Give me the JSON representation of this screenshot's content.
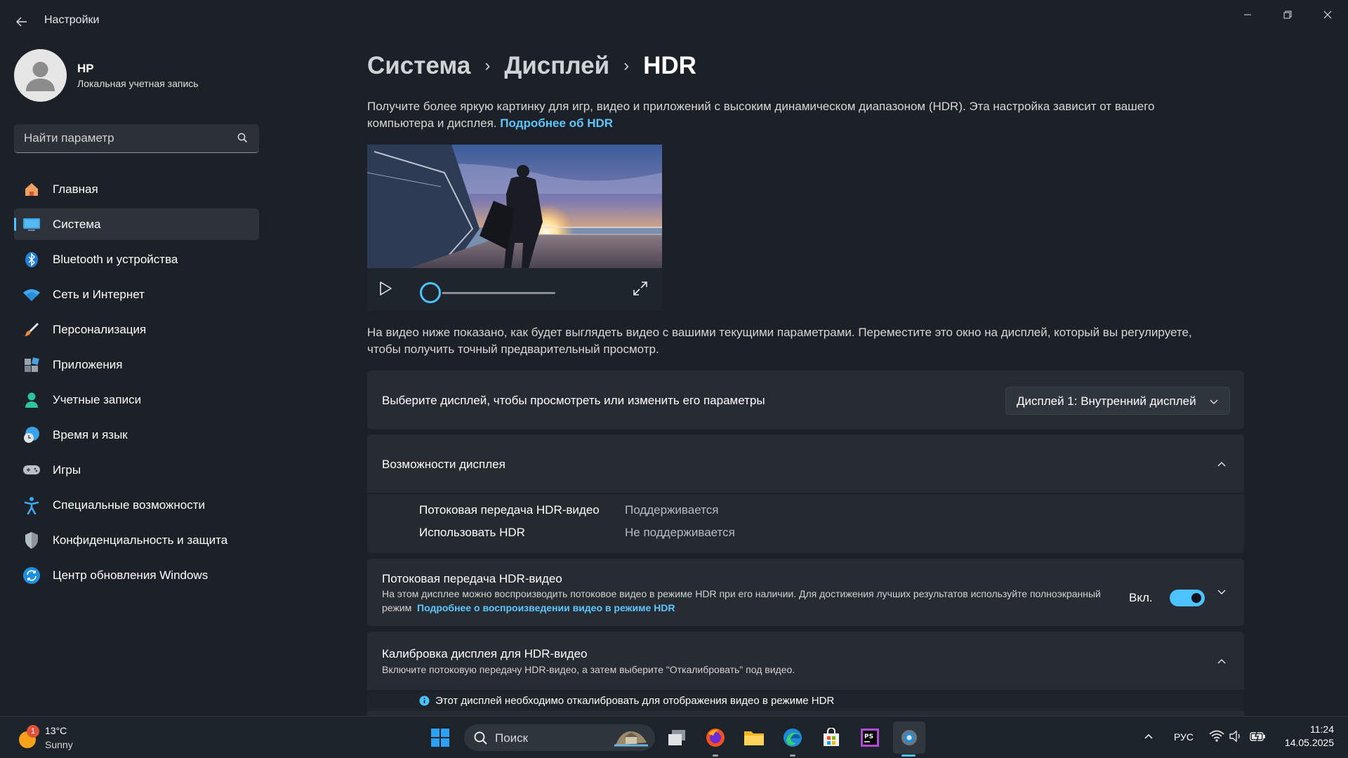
{
  "window": {
    "title": "Настройки"
  },
  "user": {
    "name": "HP",
    "account_type": "Локальная учетная запись"
  },
  "search": {
    "placeholder": "Найти параметр"
  },
  "nav": {
    "items": [
      {
        "label": "Главная",
        "icon": "home-icon"
      },
      {
        "label": "Система",
        "icon": "system-display-icon",
        "active": true
      },
      {
        "label": "Bluetooth и устройства",
        "icon": "bluetooth-icon"
      },
      {
        "label": "Сеть и Интернет",
        "icon": "wifi-icon"
      },
      {
        "label": "Персонализация",
        "icon": "brush-icon"
      },
      {
        "label": "Приложения",
        "icon": "apps-icon"
      },
      {
        "label": "Учетные записи",
        "icon": "person-icon"
      },
      {
        "label": "Время и язык",
        "icon": "globe-clock-icon"
      },
      {
        "label": "Игры",
        "icon": "gamepad-icon"
      },
      {
        "label": "Специальные возможности",
        "icon": "accessibility-icon"
      },
      {
        "label": "Конфиденциальность и защита",
        "icon": "shield-icon"
      },
      {
        "label": "Центр обновления Windows",
        "icon": "update-icon"
      }
    ]
  },
  "breadcrumb": {
    "level1": "Система",
    "level2": "Дисплей",
    "current": "HDR"
  },
  "intro": {
    "text": "Получите более яркую картинку для игр, видео и приложений с высоким динамическом диапазоном (HDR). Эта настройка зависит от вашего компьютера и дисплея.",
    "link": "Подробнее об HDR"
  },
  "video": {
    "progress": 0
  },
  "preview_note": "На видео ниже показано, как будет выглядеть видео с вашими текущими параметрами. Переместите это окно на дисплей, который вы регулируете, чтобы получить точный предварительный просмотр.",
  "display_select": {
    "label": "Выберите дисплей, чтобы просмотреть или изменить его параметры",
    "value": "Дисплей 1: Внутренний дисплей"
  },
  "capabilities": {
    "title": "Возможности дисплея",
    "rows": [
      {
        "label": "Потоковая передача HDR-видео",
        "value": "Поддерживается"
      },
      {
        "label": "Использовать HDR",
        "value": "Не поддерживается"
      }
    ]
  },
  "hdr_streaming": {
    "title": "Потоковая передача HDR-видео",
    "description": "На этом дисплее можно воспроизводить потоковое видео в режиме HDR при его наличии. Для достижения лучших результатов используйте полноэкранный режим",
    "link": "Подробнее о воспроизведении видео в режиме HDR",
    "toggle_label": "Вкл.",
    "toggle_on": true
  },
  "calibration": {
    "title": "Калибровка дисплея для HDR-видео",
    "subtitle": "Включите потоковую передачу HDR-видео, а затем выберите \"Откалибровать\" под видео.",
    "info": "Этот дисплей необходимо откалибровать для отображения видео в режиме HDR"
  },
  "taskbar": {
    "weather": {
      "temp": "13°C",
      "condition": "Sunny",
      "badge": "1"
    },
    "search_placeholder": "Поиск",
    "language": "РУС",
    "time": "11:24",
    "date": "14.05.2025"
  },
  "colors": {
    "accent": "#4cc2ff",
    "background": "#1c2127",
    "card": "#272c33"
  }
}
